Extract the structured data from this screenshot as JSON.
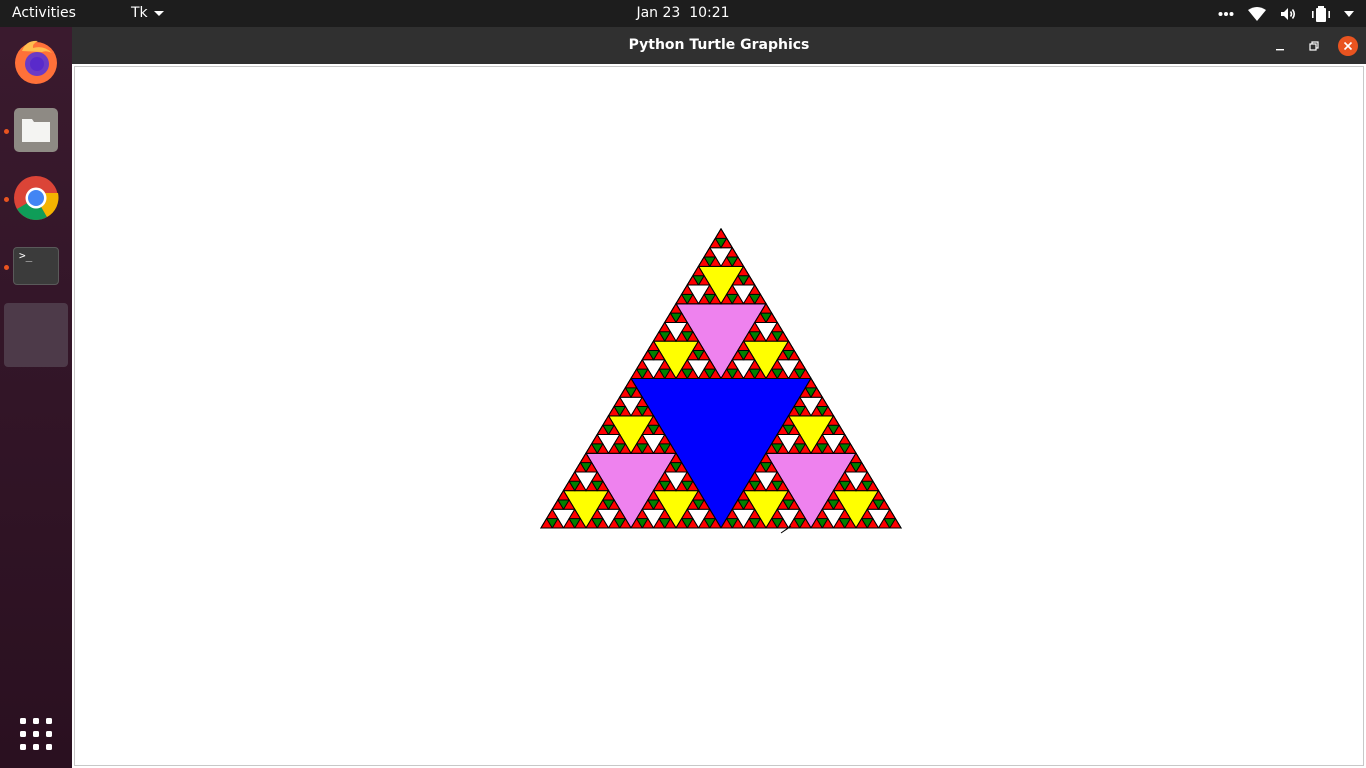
{
  "topbar": {
    "activities": "Activities",
    "app_menu": "Tk",
    "date": "Jan 23",
    "time": "10:21"
  },
  "icons": {
    "topbar": [
      "more-icon",
      "wifi-icon",
      "volume-icon",
      "battery-icon",
      "caret-down-icon"
    ],
    "dock": [
      "firefox-icon",
      "files-icon",
      "chrome-icon",
      "terminal-icon",
      "tk-window-icon",
      "app-grid-icon"
    ],
    "window_controls": [
      "minimize-icon",
      "maximize-icon",
      "close-icon"
    ]
  },
  "dock": {
    "terminal_prompt": ">_",
    "running_indicators": [
      "files",
      "chrome",
      "terminal",
      "tk"
    ]
  },
  "window": {
    "title": "Python Turtle Graphics"
  },
  "turtle_drawing": {
    "type": "sierpinski-triangle",
    "depth": 5,
    "outline_color": "#000000",
    "level_colors": [
      "#0000ff",
      "#ee82ee",
      "#ffff00",
      "#ffffff",
      "#008000",
      "#ff0000"
    ],
    "background": "#ffffff"
  },
  "colors": {
    "accent": "#e95420",
    "close_button": "#e95420"
  }
}
